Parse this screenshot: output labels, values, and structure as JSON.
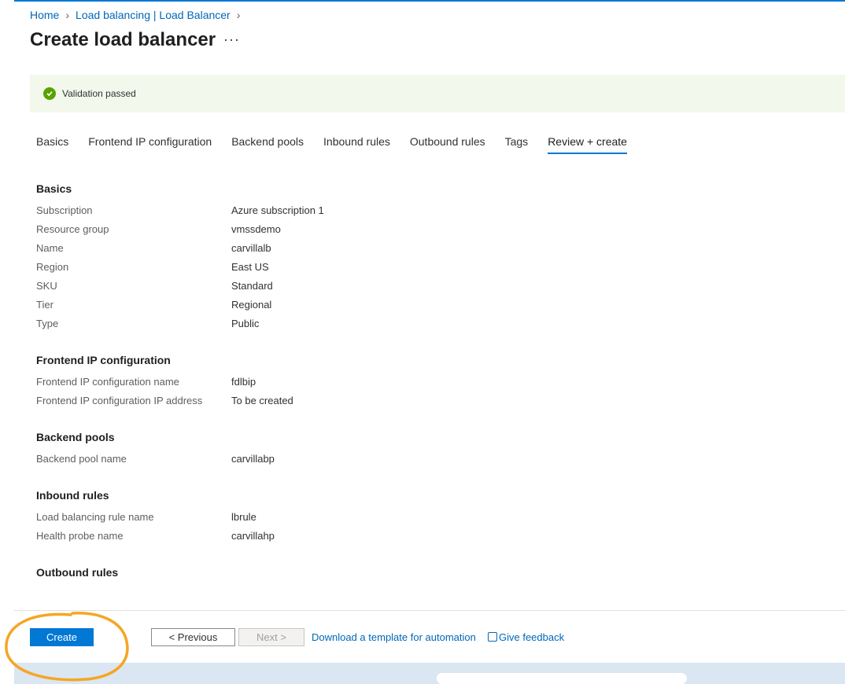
{
  "breadcrumb": {
    "items": [
      "Home",
      "Load balancing | Load Balancer"
    ]
  },
  "page": {
    "title": "Create load balancer",
    "more": "···"
  },
  "validation": {
    "text": "Validation passed"
  },
  "tabs": [
    "Basics",
    "Frontend IP configuration",
    "Backend pools",
    "Inbound rules",
    "Outbound rules",
    "Tags",
    "Review + create"
  ],
  "sections": {
    "basics": {
      "title": "Basics",
      "rows": [
        {
          "k": "Subscription",
          "v": "Azure subscription 1"
        },
        {
          "k": "Resource group",
          "v": "vmssdemo"
        },
        {
          "k": "Name",
          "v": "carvillalb"
        },
        {
          "k": "Region",
          "v": "East US"
        },
        {
          "k": "SKU",
          "v": "Standard"
        },
        {
          "k": "Tier",
          "v": "Regional"
        },
        {
          "k": "Type",
          "v": "Public"
        }
      ]
    },
    "frontend": {
      "title": "Frontend IP configuration",
      "rows": [
        {
          "k": "Frontend IP configuration name",
          "v": "fdlbip"
        },
        {
          "k": "Frontend IP configuration IP address",
          "v": "To be created"
        }
      ]
    },
    "backend": {
      "title": "Backend pools",
      "rows": [
        {
          "k": "Backend pool name",
          "v": "carvillabp"
        }
      ]
    },
    "inbound": {
      "title": "Inbound rules",
      "rows": [
        {
          "k": "Load balancing rule name",
          "v": "lbrule"
        },
        {
          "k": "Health probe name",
          "v": "carvillahp"
        }
      ]
    },
    "outbound": {
      "title": "Outbound rules"
    }
  },
  "footer": {
    "create": "Create",
    "previous": "< Previous",
    "next": "Next >",
    "download": "Download a template for automation",
    "feedback": "Give feedback"
  },
  "colors": {
    "accent": "#0078d4",
    "success": "#57a300",
    "annotation": "#f5a623"
  }
}
